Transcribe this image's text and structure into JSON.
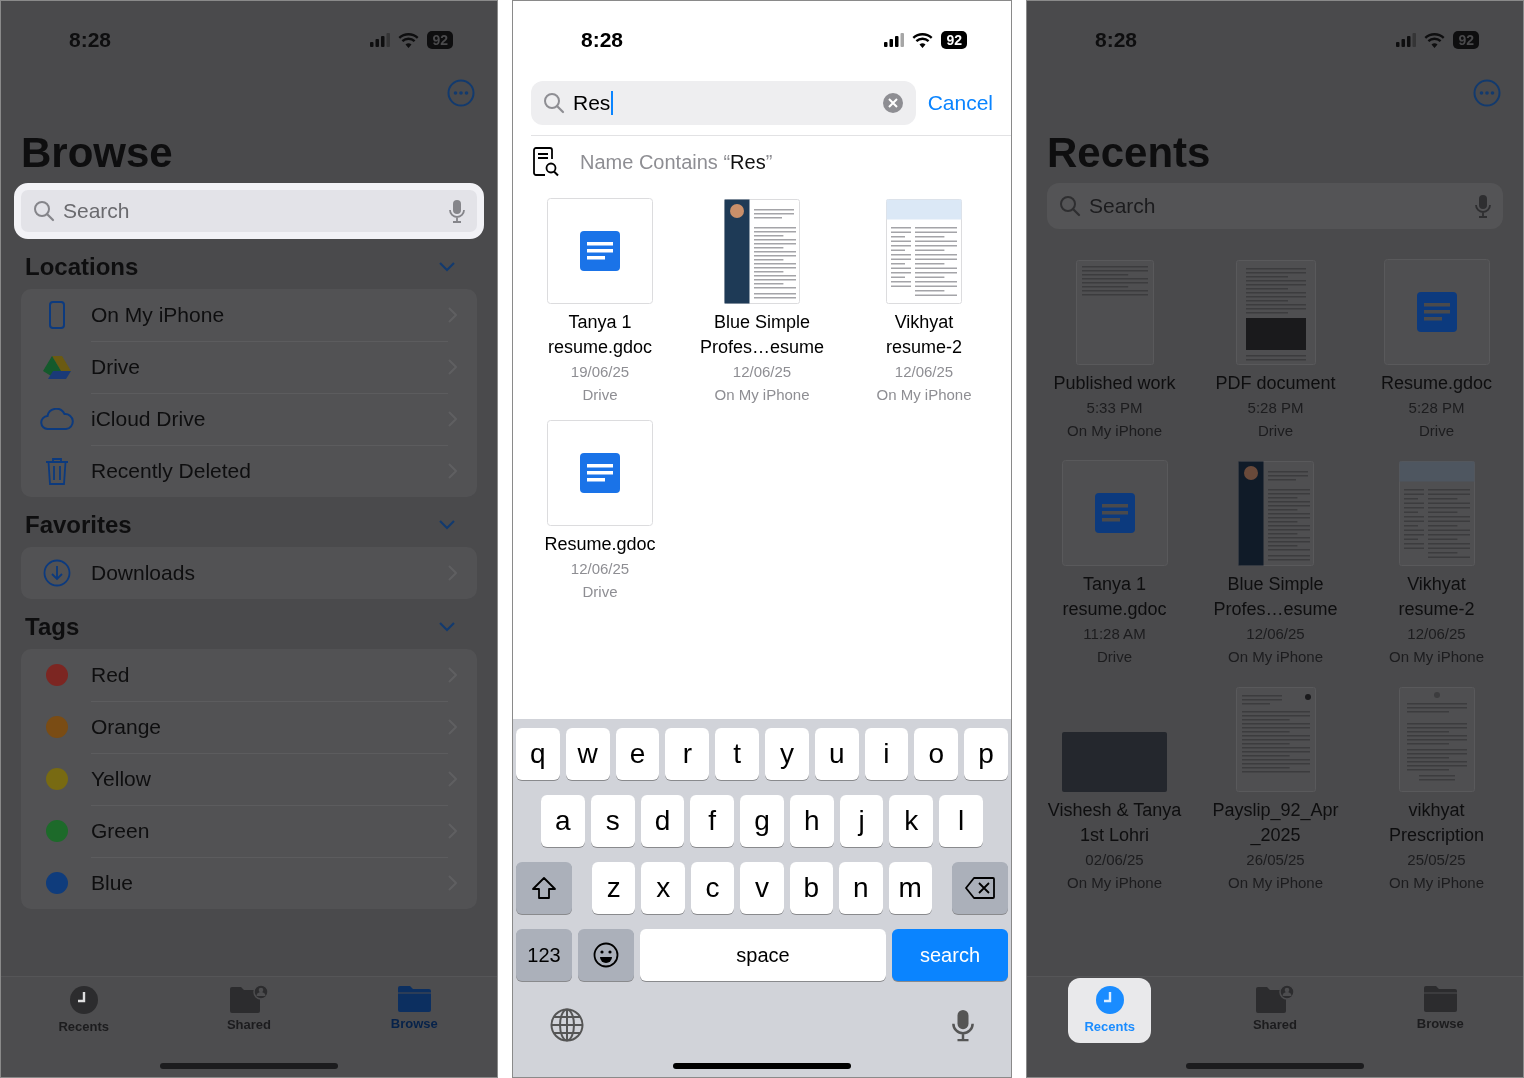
{
  "browse_screen": {
    "status_bar": {
      "time": "8:28",
      "battery": "92"
    },
    "title": "Browse",
    "search": {
      "placeholder": "Search",
      "highlighted": true
    },
    "sections": [
      {
        "title": "Locations",
        "expanded": true,
        "items": [
          {
            "label": "On My iPhone",
            "kind": "device"
          },
          {
            "label": "Drive",
            "kind": "drive"
          },
          {
            "label": "iCloud Drive",
            "kind": "cloud"
          },
          {
            "label": "Recently Deleted",
            "kind": "trash"
          }
        ]
      },
      {
        "title": "Favorites",
        "expanded": true,
        "items": [
          {
            "label": "Downloads",
            "kind": "download"
          }
        ]
      },
      {
        "title": "Tags",
        "expanded": true,
        "items": [
          {
            "label": "Red",
            "kind": "tag",
            "color": "#7c2622"
          },
          {
            "label": "Orange",
            "kind": "tag",
            "color": "#7a4c14"
          },
          {
            "label": "Yellow",
            "kind": "tag",
            "color": "#786a12"
          },
          {
            "label": "Green",
            "kind": "tag",
            "color": "#1d6a2a"
          },
          {
            "label": "Blue",
            "kind": "tag",
            "color": "#0f3c7c"
          }
        ]
      }
    ],
    "tab_bar": [
      {
        "label": "Recents",
        "kind": "clock",
        "selected": false,
        "highlighted": false
      },
      {
        "label": "Shared",
        "kind": "shared",
        "selected": false,
        "highlighted": false
      },
      {
        "label": "Browse",
        "kind": "folder",
        "selected": true,
        "highlighted": false
      }
    ]
  },
  "search_screen": {
    "status_bar": {
      "time": "8:28",
      "battery": "92"
    },
    "search": {
      "value": "Res"
    },
    "cancel": "Cancel",
    "suggestion": "Name Contains “**Res**”",
    "results": [
      {
        "name": "Tanya 1\nresume.gdoc",
        "date": "19/06/25",
        "location": "Drive",
        "kind": "gdoc"
      },
      {
        "name": "Blue Simple\nProfes…esume",
        "date": "12/06/25",
        "location": "On My iPhone",
        "kind": "resume-dark"
      },
      {
        "name": "Vikhyat\nresume-2",
        "date": "12/06/25",
        "location": "On My iPhone",
        "kind": "resume-light"
      },
      {
        "name": "Resume.gdoc",
        "date": "12/06/25",
        "location": "Drive",
        "kind": "gdoc"
      }
    ],
    "keyboard": {
      "letter_rows": [
        [
          "q",
          "w",
          "e",
          "r",
          "t",
          "y",
          "u",
          "i",
          "o",
          "p"
        ],
        [
          "a",
          "s",
          "d",
          "f",
          "g",
          "h",
          "j",
          "k",
          "l"
        ],
        [
          "z",
          "x",
          "c",
          "v",
          "b",
          "n",
          "m"
        ]
      ],
      "numbers_key": "123",
      "space_key": "space",
      "return_key": "search"
    }
  },
  "recents_screen": {
    "status_bar": {
      "time": "8:28",
      "battery": "92"
    },
    "title": "Recents",
    "search": {
      "placeholder": "Search",
      "highlighted": false
    },
    "files": [
      {
        "name": "Published work",
        "date": "5:33 PM",
        "location": "On My iPhone",
        "kind": "text-doc"
      },
      {
        "name": "PDF document",
        "date": "5:28 PM",
        "location": "Drive",
        "kind": "pdf"
      },
      {
        "name": "Resume.gdoc",
        "date": "5:28 PM",
        "location": "Drive",
        "kind": "gdoc"
      },
      {
        "name": "Tanya 1\nresume.gdoc",
        "date": "11:28 AM",
        "location": "Drive",
        "kind": "gdoc"
      },
      {
        "name": "Blue Simple\nProfes…esume",
        "date": "12/06/25",
        "location": "On My iPhone",
        "kind": "resume-dark"
      },
      {
        "name": "Vikhyat\nresume-2",
        "date": "12/06/25",
        "location": "On My iPhone",
        "kind": "resume-light"
      },
      {
        "name": "Vishesh & Tanya\n1st Lohri",
        "date": "02/06/25",
        "location": "On My iPhone",
        "kind": "photo"
      },
      {
        "name": "Payslip_92_Apr\n_2025",
        "date": "26/05/25",
        "location": "On My iPhone",
        "kind": "payslip"
      },
      {
        "name": "vikhyat\nPrescription",
        "date": "25/05/25",
        "location": "On My iPhone",
        "kind": "prescription"
      }
    ],
    "tab_bar": [
      {
        "label": "Recents",
        "kind": "clock",
        "selected": true,
        "highlighted": true
      },
      {
        "label": "Shared",
        "kind": "shared",
        "selected": false,
        "highlighted": false
      },
      {
        "label": "Browse",
        "kind": "folder",
        "selected": false,
        "highlighted": false
      }
    ]
  }
}
